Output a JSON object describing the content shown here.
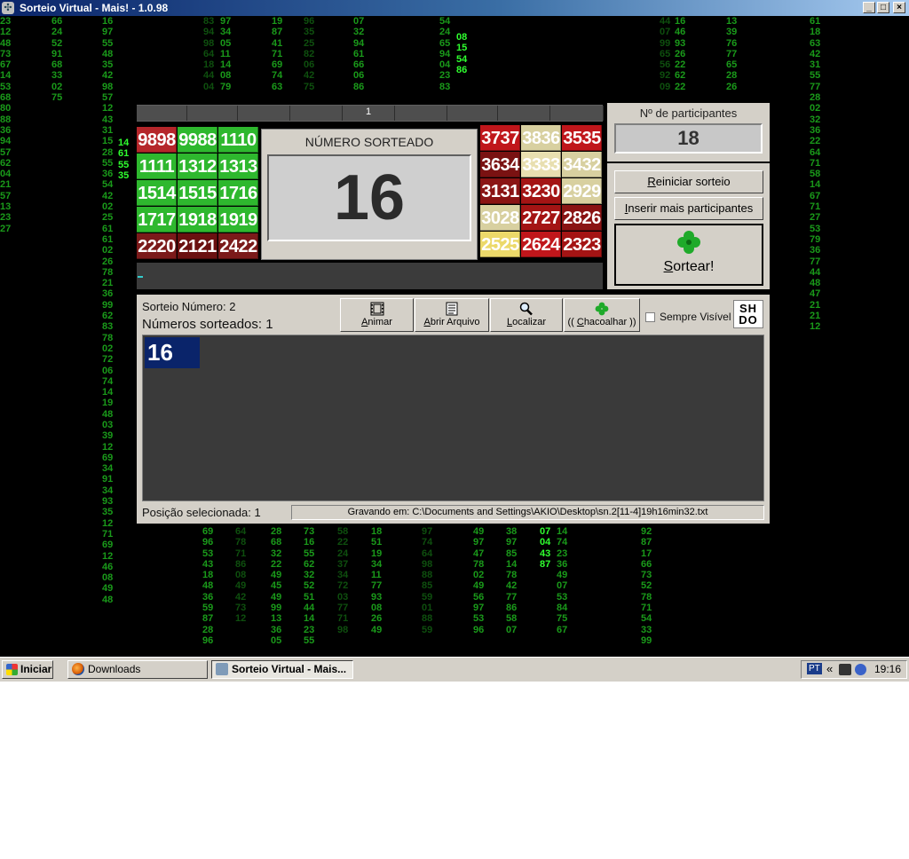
{
  "window": {
    "title": "Sorteio Virtual - Mais! - 1.0.98",
    "controls": {
      "minimize": "_",
      "maximize": "□",
      "close": "×"
    }
  },
  "ruler": {
    "marker": "1"
  },
  "board": {
    "left_cells": [
      {
        "text": "9898",
        "color": "#b5262a"
      },
      {
        "text": "9988",
        "color": "#2eb82e"
      },
      {
        "text": "1110",
        "color": "#2eb82e"
      },
      {
        "text": "1111",
        "color": "#2eb82e"
      },
      {
        "text": "1312",
        "color": "#2eb82e"
      },
      {
        "text": "1313",
        "color": "#2eb82e"
      },
      {
        "text": "1514",
        "color": "#2eb82e"
      },
      {
        "text": "1515",
        "color": "#2eb82e"
      },
      {
        "text": "1716",
        "color": "#2eb82e"
      },
      {
        "text": "1717",
        "color": "#2eb82e"
      },
      {
        "text": "1918",
        "color": "#2eb82e"
      },
      {
        "text": "1919",
        "color": "#2eb82e"
      },
      {
        "text": "2220",
        "color": "#7b1a1a"
      },
      {
        "text": "2121",
        "color": "#6a1010"
      },
      {
        "text": "2422",
        "color": "#7b1a1a"
      }
    ],
    "right_cells": [
      {
        "text": "3737",
        "color": "#c0161b"
      },
      {
        "text": "3836",
        "color": "#d8d0a0"
      },
      {
        "text": "3535",
        "color": "#c0161b"
      },
      {
        "text": "3634",
        "color": "#7a1212"
      },
      {
        "text": "3333",
        "color": "#e8dfb0"
      },
      {
        "text": "3432",
        "color": "#d8d0a0"
      },
      {
        "text": "3131",
        "color": "#8a1414"
      },
      {
        "text": "3230",
        "color": "#a41414"
      },
      {
        "text": "2929",
        "color": "#d8d0a0"
      },
      {
        "text": "3028",
        "color": "#d8d0a0"
      },
      {
        "text": "2727",
        "color": "#a41414"
      },
      {
        "text": "2826",
        "color": "#8a1414"
      },
      {
        "text": "2525",
        "color": "#ecd96a"
      },
      {
        "text": "2624",
        "color": "#c0161b"
      },
      {
        "text": "2323",
        "color": "#a41414"
      }
    ]
  },
  "drawn": {
    "caption": "NÚMERO SORTEADO",
    "number": "16"
  },
  "participants": {
    "label": "Nº de participantes",
    "count": "18"
  },
  "actions": {
    "restart": "Reiniciar sorteio",
    "insert_more": "Inserir mais participantes",
    "draw": "Sortear!"
  },
  "session": {
    "draw_number": "Sorteio Número: 2",
    "numbers_drawn": "Números sorteados: 1",
    "selected_position": "Posição selecionada: 1",
    "saving_to": "Gravando em: C:\\Documents and Settings\\AKIO\\Desktop\\sn.2[11-4]19h16min32.txt"
  },
  "tools": {
    "animate": "Animar",
    "open_file": "Abrir Arquivo",
    "find": "Localizar",
    "shake": "(( Chacoalhar ))",
    "always_visible": "Sempre Visível",
    "logo": "SH DO"
  },
  "results": [
    "16"
  ],
  "taskbar": {
    "start": "Iniciar",
    "tasks": [
      "Downloads",
      "Sorteio Virtual - Mais..."
    ],
    "lang": "PT",
    "tray_arrows": "«",
    "clock": "19:16"
  },
  "matrix_columns": [
    {
      "text": "23\n12\n48\n73\n67\n14\n53\n68\n80\n88\n36\n94\n57\n62\n04\n21\n57\n13\n23\n27",
      "tone": "mdim"
    },
    {
      "text": "66\n24\n52\n91\n68\n33\n02\n75",
      "tone": "mdim"
    },
    {
      "text": "16\n97\n55\n48\n35\n42\n98\n57\n12\n43\n31\n15\n28\n55\n36\n54\n42\n02\n25\n61\n61\n02\n26\n78\n21\n36\n99\n62\n83\n78\n02\n72\n06\n74\n14\n19\n48\n03\n39\n12\n69\n34\n91\n34\n93\n35\n12\n71\n69\n12\n46\n08\n49\n48",
      "tone": "mdim"
    },
    {
      "text": "14\n61\n55\n35",
      "tone": "mbright"
    },
    {
      "text": "83\n94\n98\n64\n18\n44\n04",
      "tone": "mfaint"
    },
    {
      "text": "97\n34\n05\n11\n14\n08\n79",
      "tone": "mdim"
    },
    {
      "text": "19\n87\n41\n71\n69\n74\n63",
      "tone": "mdim"
    },
    {
      "text": "96\n35\n25\n82\n06\n42\n75",
      "tone": "mfaint"
    },
    {
      "text": "07\n32\n94\n61\n66\n06\n86",
      "tone": "mdim"
    },
    {
      "text": "54\n24\n65\n94\n04\n23\n83",
      "tone": "mdim"
    },
    {
      "text": "08\n15\n54\n86",
      "tone": "mbright"
    },
    {
      "text": "44\n07\n99\n65\n56\n92\n09",
      "tone": "mfaint"
    },
    {
      "text": "16\n46\n93\n26\n22\n62\n22",
      "tone": "mdim"
    },
    {
      "text": "13\n39\n76\n77\n65\n28\n26",
      "tone": "mdim"
    },
    {
      "text": "61\n18\n63\n42\n31\n55\n77\n28\n02\n32\n36\n22\n64\n71\n58\n14\n67\n71\n27\n53\n79\n36\n77\n44\n48\n47\n21\n21\n12",
      "tone": "mdim"
    },
    {
      "text": "69\n96\n53\n43\n18\n48\n36\n59\n87\n28\n96",
      "tone": "mdim"
    },
    {
      "text": "64\n78\n71\n86\n08\n49\n42\n73\n12",
      "tone": "mfaint"
    },
    {
      "text": "28\n68\n32\n22\n49\n45\n49\n99\n13\n36\n05",
      "tone": "mdim"
    },
    {
      "text": "73\n16\n55\n62\n32\n52\n51\n44\n14\n23\n55",
      "tone": "mdim"
    },
    {
      "text": "58\n22\n24\n37\n34\n72\n03\n77\n71\n98",
      "tone": "mfaint"
    },
    {
      "text": "18\n51\n19\n34\n11\n77\n93\n08\n26\n49",
      "tone": "mdim"
    },
    {
      "text": "97\n74\n64\n98\n88\n85\n59\n01\n88\n59",
      "tone": "mfaint"
    },
    {
      "text": "49\n97\n47\n78\n02\n49\n56\n97\n53\n96",
      "tone": "mdim"
    },
    {
      "text": "38\n97\n85\n14\n78\n42\n77\n86\n58\n07",
      "tone": "mdim"
    },
    {
      "text": "07\n04\n43\n87",
      "tone": "mbright"
    },
    {
      "text": "14\n74\n23\n36\n49\n07\n53\n84\n75\n67",
      "tone": "mdim"
    },
    {
      "text": "92\n87\n17\n66\n73\n52\n78\n71\n54\n33\n99",
      "tone": "mdim"
    }
  ]
}
